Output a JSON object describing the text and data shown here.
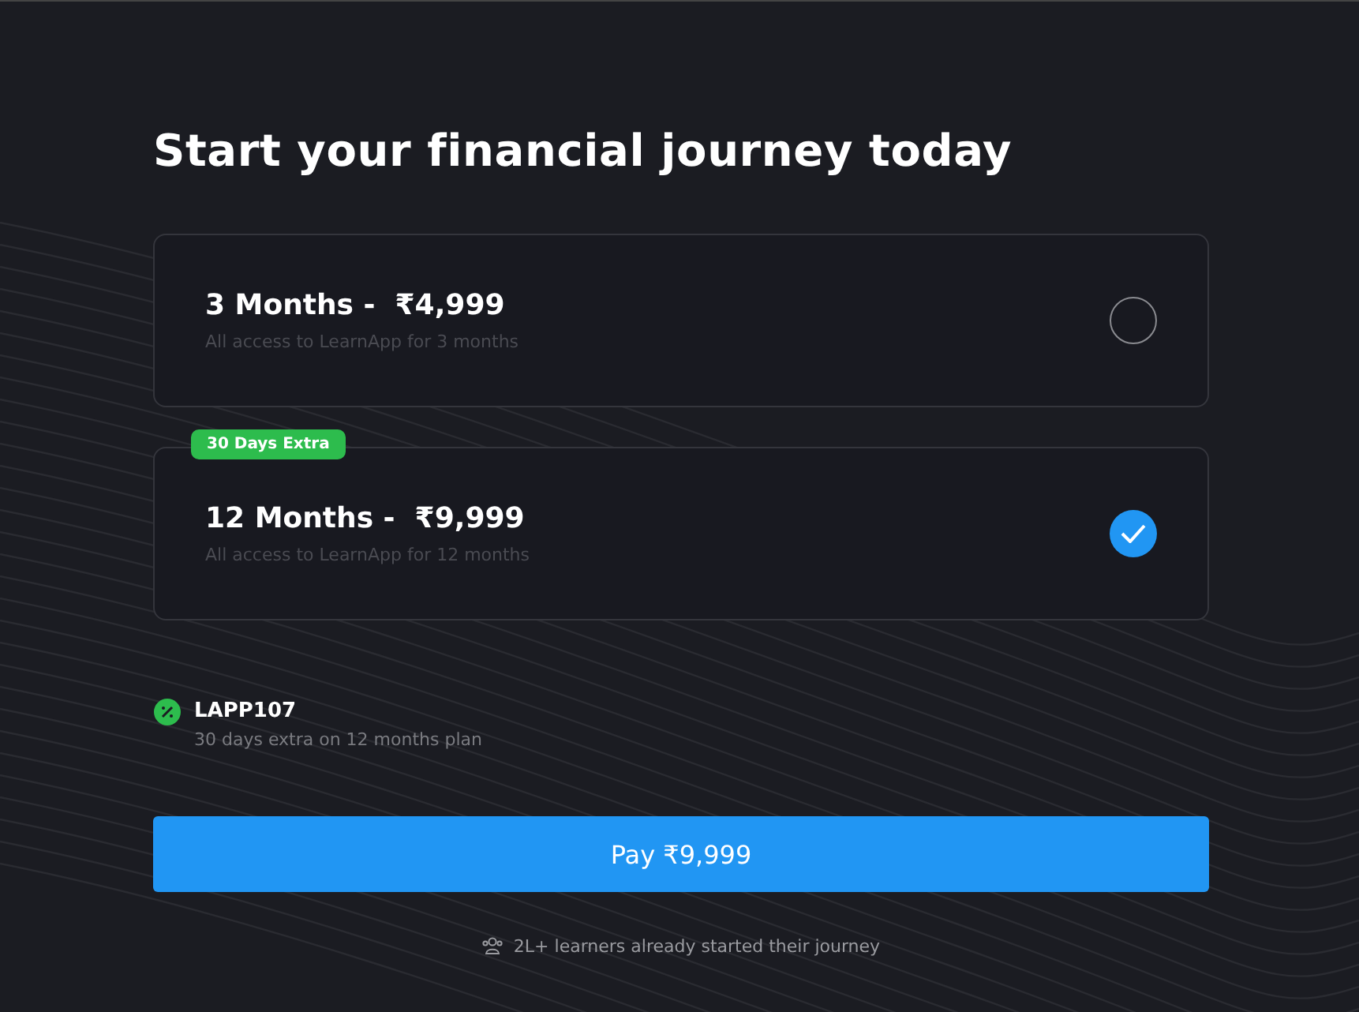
{
  "title": "Start your financial journey today",
  "plans": [
    {
      "name": "3 Months -  ₹4,999",
      "description": "All access to LearnApp for 3 months",
      "selected": false
    },
    {
      "name": "12 Months -  ₹9,999",
      "description": "All access to LearnApp for 12 months",
      "selected": true,
      "badge": "30 Days Extra"
    }
  ],
  "coupon": {
    "code": "LAPP107",
    "description": "30 days extra on 12 months plan"
  },
  "pay_button": "Pay ₹9,999",
  "footer": "2L+ learners already started their journey"
}
